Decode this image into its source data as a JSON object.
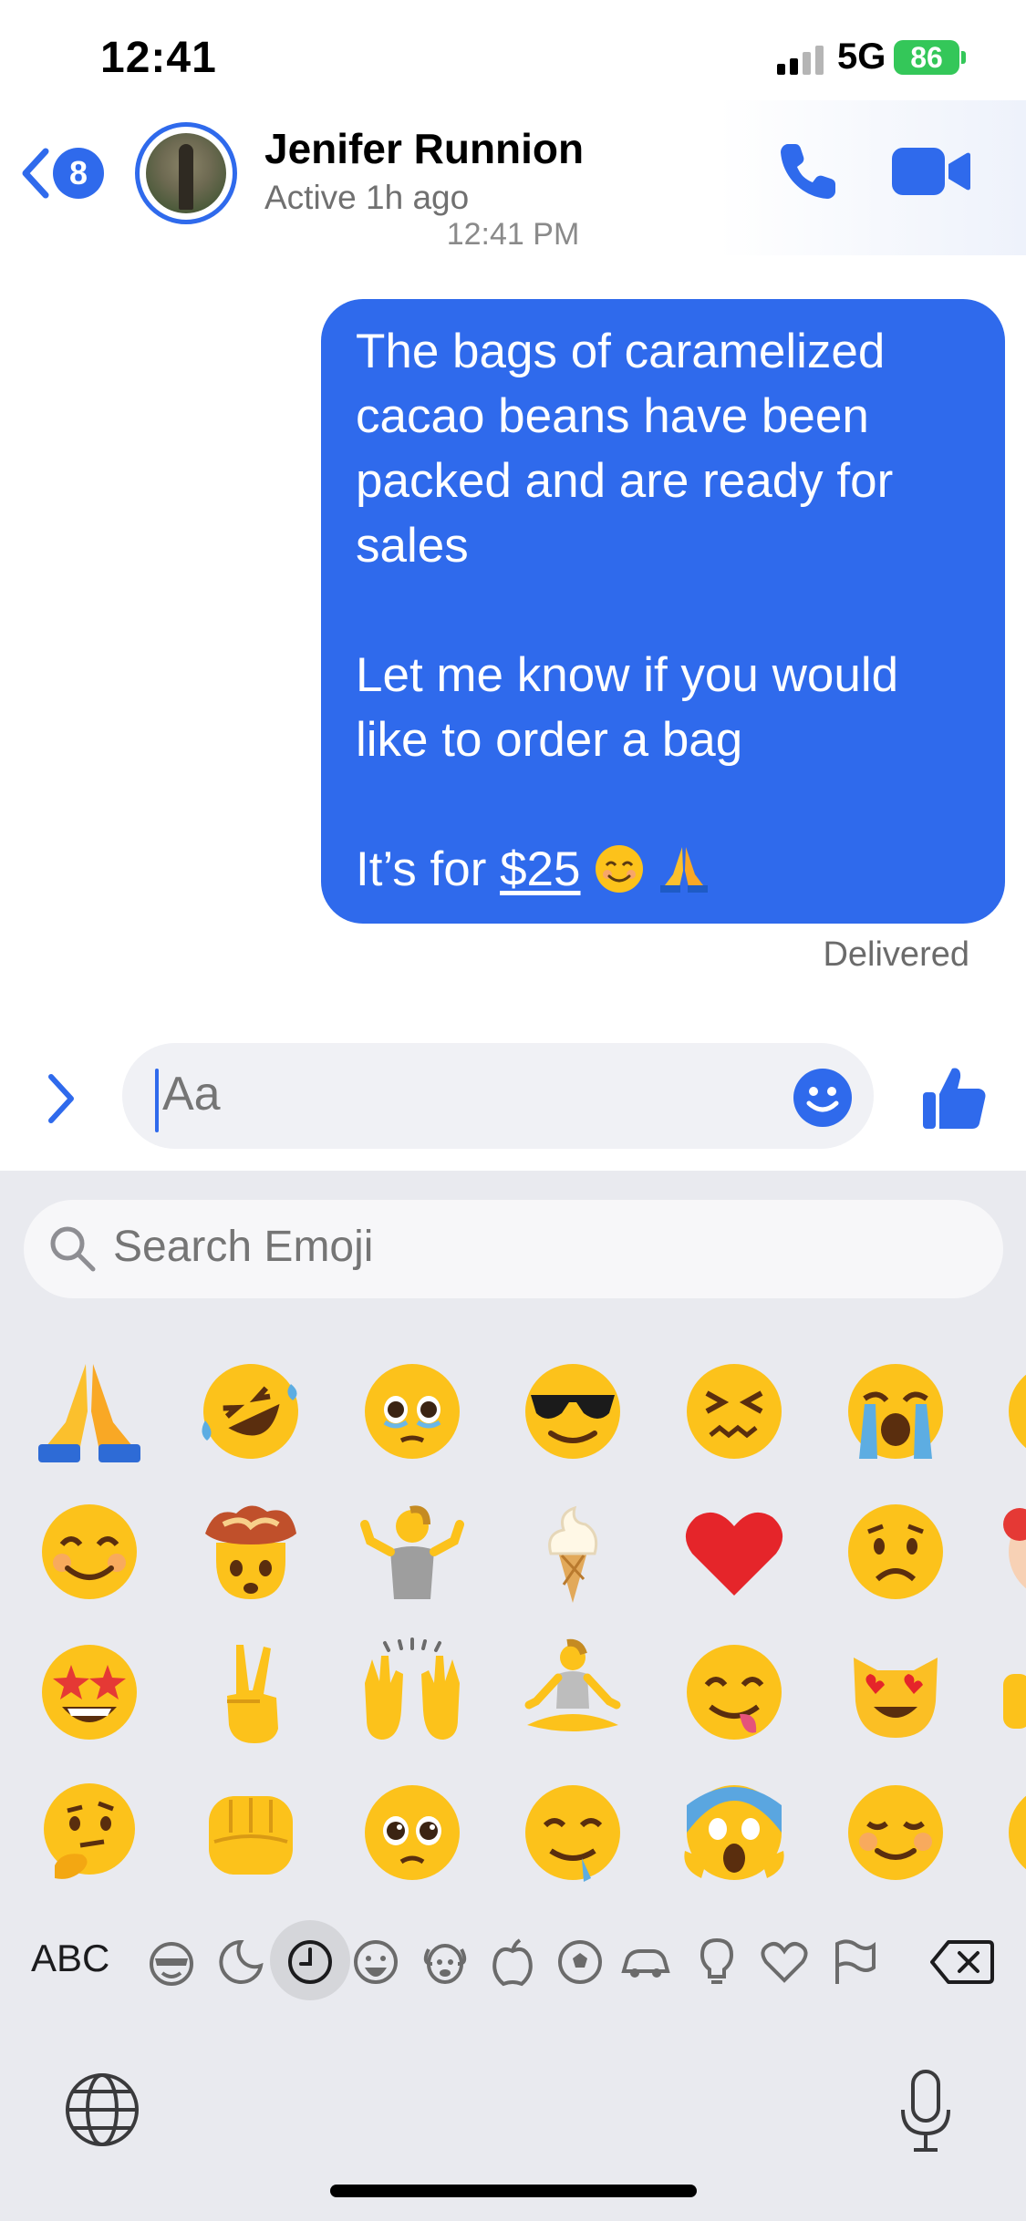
{
  "status_bar": {
    "time": "12:41",
    "network": "5G",
    "battery": "86"
  },
  "header": {
    "back_count": "8",
    "contact_name": "Jenifer Runnion",
    "status": "Active 1h ago"
  },
  "conversation": {
    "timestamp": "12:41 PM",
    "message": {
      "para1": "The bags of caramelized cacao beans have been packed and are ready for sales",
      "para2": "Let me know if you would like to order a bag",
      "para3_prefix": "It’s for ",
      "price": "$25",
      "trailing_emojis": [
        "smiling-face-with-smiling-eyes",
        "folded-hands"
      ]
    },
    "delivery_status": "Delivered"
  },
  "composer": {
    "placeholder": "Aa"
  },
  "emoji_keyboard": {
    "search_placeholder": "Search Emoji",
    "recent_emojis": [
      [
        "folded-hands",
        "rolling-on-floor-laughing",
        "face-holding-back-tears",
        "smiling-face-with-sunglasses",
        "confounded-face",
        "loudly-crying-face"
      ],
      [
        "smiling-face-with-smiling-eyes",
        "exploding-head",
        "person-shrugging",
        "soft-ice-cream",
        "red-heart",
        "worried-face"
      ],
      [
        "star-struck",
        "victory-hand",
        "raising-hands",
        "person-in-lotus-position",
        "face-savoring-food",
        "smiling-cat-with-heart-eyes"
      ],
      [
        "thinking-face",
        "oncoming-fist",
        "pleading-face",
        "drooling-face",
        "face-screaming-in-fear",
        "smiling-face"
      ]
    ],
    "abc_label": "ABC",
    "categories": [
      "smileys",
      "animals-nature",
      "recent",
      "people",
      "food",
      "activity",
      "travel",
      "objects",
      "symbols",
      "flags"
    ],
    "selected_category": "recent"
  }
}
